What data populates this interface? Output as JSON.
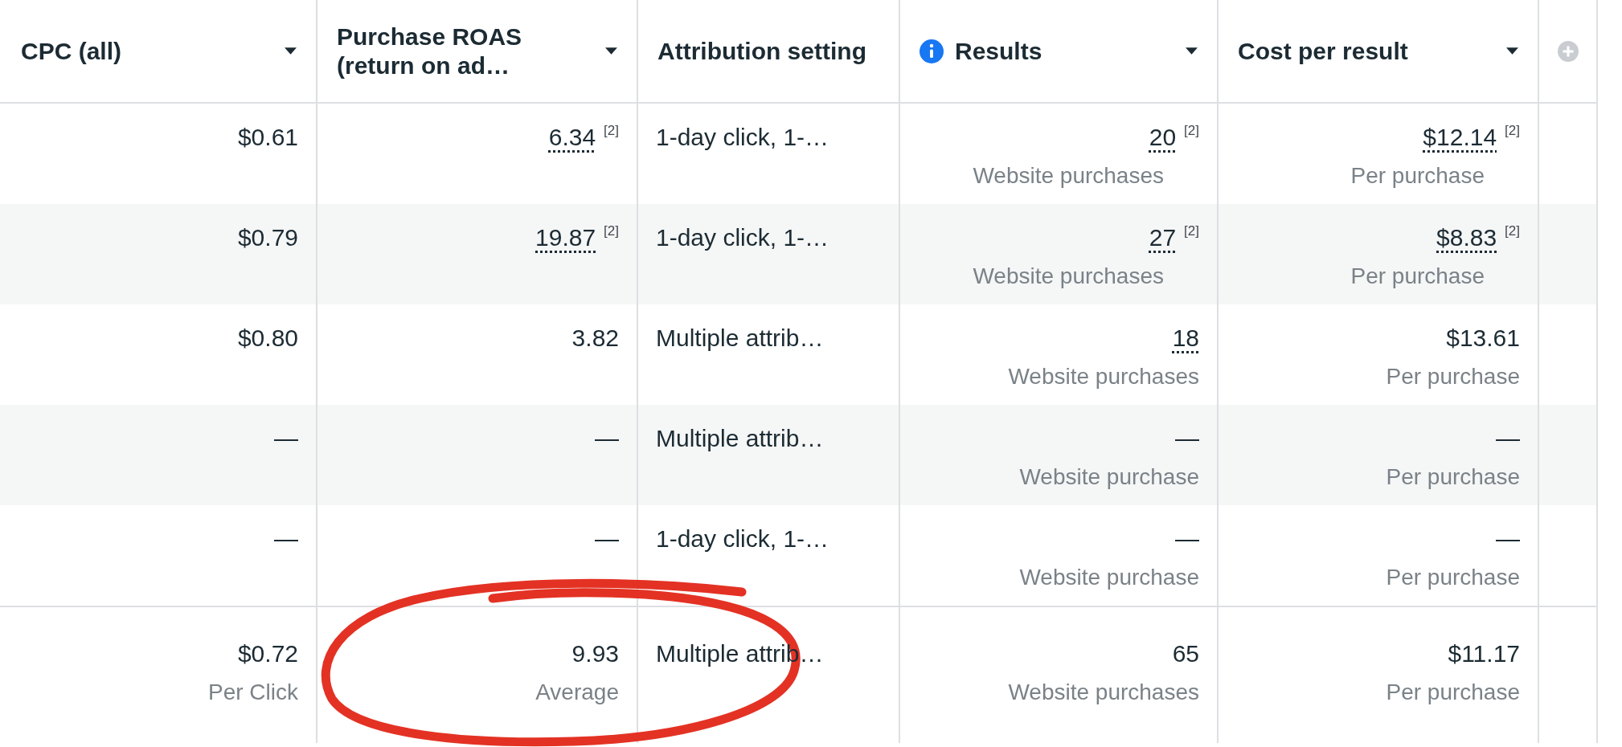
{
  "columns": [
    {
      "label": "CPC (all)",
      "info": false,
      "sortable": true
    },
    {
      "label": "Purchase ROAS (return on ad…",
      "info": false,
      "sortable": true
    },
    {
      "label": "Attribution setting",
      "info": false,
      "sortable": false
    },
    {
      "label": "Results",
      "info": true,
      "sortable": true
    },
    {
      "label": "Cost per result",
      "info": false,
      "sortable": true
    }
  ],
  "rows": [
    {
      "cpc": "$0.61",
      "roas": {
        "value": "6.34",
        "dotted": true,
        "note": "[2]"
      },
      "attribution": "1-day click, 1-…",
      "results": {
        "value": "20",
        "dotted": true,
        "note": "[2]",
        "label": "Website purchases"
      },
      "cost": {
        "value": "$12.14",
        "dotted": true,
        "note": "[2]",
        "label": "Per purchase"
      }
    },
    {
      "cpc": "$0.79",
      "roas": {
        "value": "19.87",
        "dotted": true,
        "note": "[2]"
      },
      "attribution": "1-day click, 1-…",
      "results": {
        "value": "27",
        "dotted": true,
        "note": "[2]",
        "label": "Website purchases"
      },
      "cost": {
        "value": "$8.83",
        "dotted": true,
        "note": "[2]",
        "label": "Per purchase"
      }
    },
    {
      "cpc": "$0.80",
      "roas": {
        "value": "3.82",
        "dotted": false
      },
      "attribution": "Multiple attrib…",
      "results": {
        "value": "18",
        "dotted": true,
        "label": "Website purchases"
      },
      "cost": {
        "value": "$13.61",
        "dotted": false,
        "label": "Per purchase"
      }
    },
    {
      "cpc": "—",
      "roas": {
        "value": "—",
        "dotted": false
      },
      "attribution": "Multiple attrib…",
      "results": {
        "value": "—",
        "dotted": false,
        "label": "Website purchase"
      },
      "cost": {
        "value": "—",
        "dotted": false,
        "label": "Per purchase"
      }
    },
    {
      "cpc": "—",
      "roas": {
        "value": "—",
        "dotted": false
      },
      "attribution": "1-day click, 1-…",
      "results": {
        "value": "—",
        "dotted": false,
        "label": "Website purchase"
      },
      "cost": {
        "value": "—",
        "dotted": false,
        "label": "Per purchase"
      }
    }
  ],
  "summary": {
    "cpc": {
      "value": "$0.72",
      "label": "Per Click"
    },
    "roas": {
      "value": "9.93",
      "label": "Average"
    },
    "attribution": "Multiple attrib…",
    "results": {
      "value": "65",
      "label": "Website purchases"
    },
    "cost": {
      "value": "$11.17",
      "label": "Per purchase"
    }
  }
}
